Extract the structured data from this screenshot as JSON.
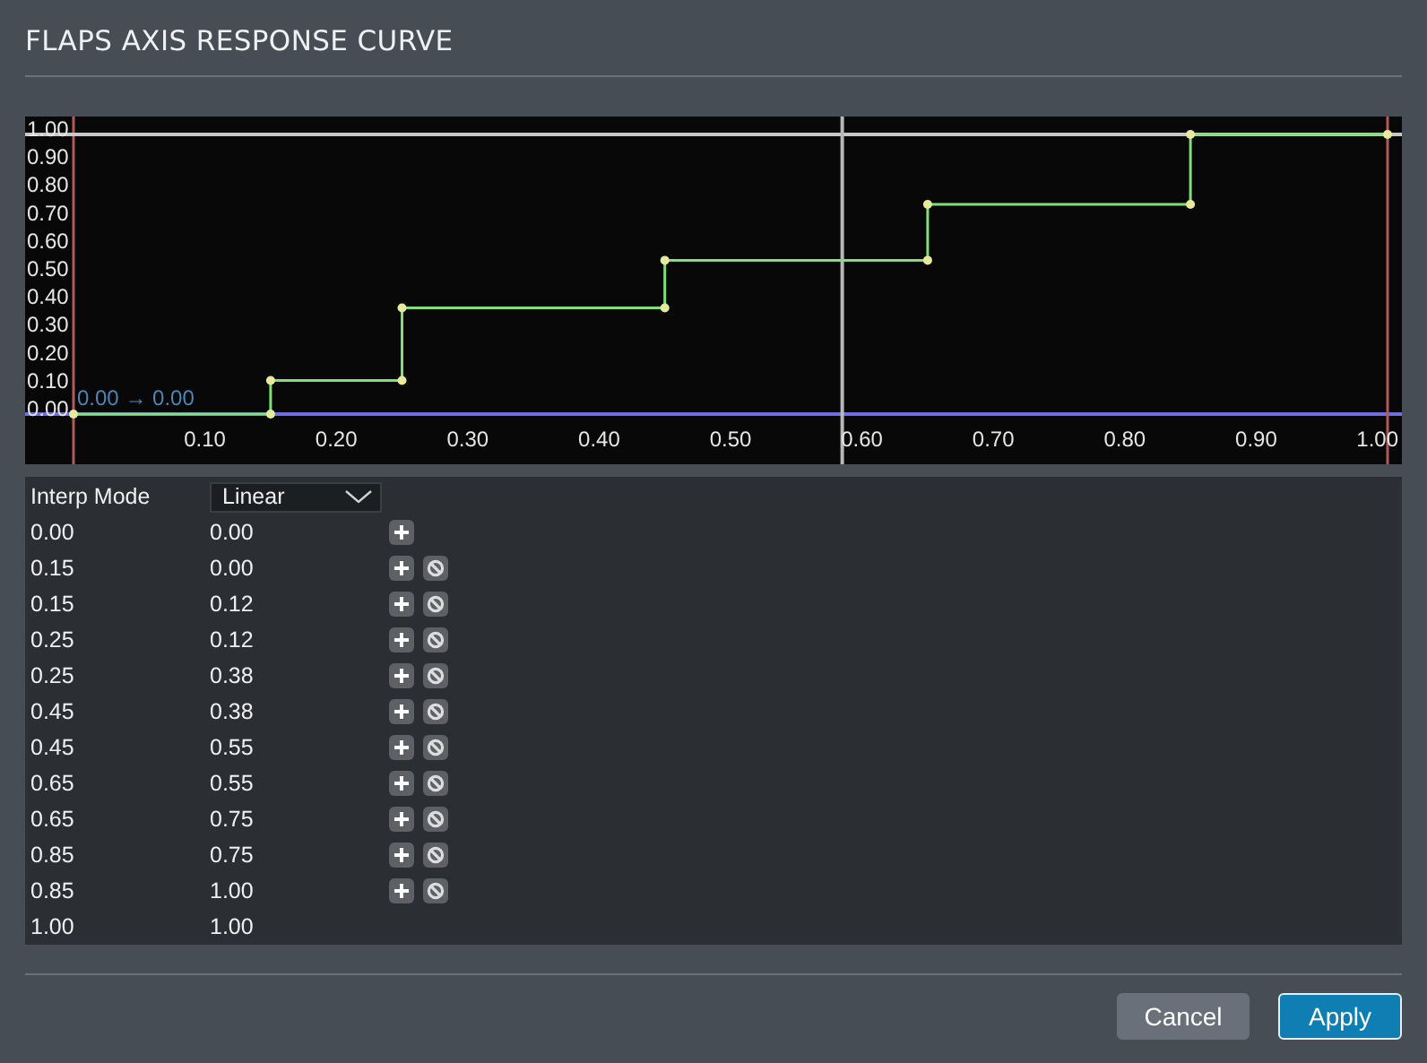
{
  "window": {
    "title": "FLAPS AXIS RESPONSE CURVE"
  },
  "chart": {
    "chart_data": {
      "type": "line",
      "x": [
        0,
        0.15,
        0.15,
        0.25,
        0.25,
        0.45,
        0.45,
        0.65,
        0.65,
        0.85,
        0.85,
        1
      ],
      "series": [
        {
          "color": "#7fe07a",
          "marker": "o",
          "values": [
            0,
            0,
            0.12,
            0.12,
            0.38,
            0.38,
            0.55,
            0.55,
            0.75,
            0.75,
            1,
            1
          ]
        }
      ],
      "xlim": [
        0,
        1
      ],
      "ylim": [
        0,
        1
      ],
      "xticks": [
        {
          "value": 0.1,
          "label": "0.10"
        },
        {
          "value": 0.2,
          "label": "0.20"
        },
        {
          "value": 0.3,
          "label": "0.30"
        },
        {
          "value": 0.4,
          "label": "0.40"
        },
        {
          "value": 0.5,
          "label": "0.50"
        },
        {
          "value": 0.6,
          "label": "0.60"
        },
        {
          "value": 0.7,
          "label": "0.70"
        },
        {
          "value": 0.8,
          "label": "0.80"
        },
        {
          "value": 0.9,
          "label": "0.90"
        },
        {
          "value": 1,
          "label": "1.00"
        }
      ],
      "yticks": [
        {
          "value": 0,
          "label": "0.00"
        },
        {
          "value": 0.1,
          "label": "0.10"
        },
        {
          "value": 0.2,
          "label": "0.20"
        },
        {
          "value": 0.3,
          "label": "0.30"
        },
        {
          "value": 0.4,
          "label": "0.40"
        },
        {
          "value": 0.5,
          "label": "0.50"
        },
        {
          "value": 0.6,
          "label": "0.60"
        },
        {
          "value": 0.7,
          "label": "0.70"
        },
        {
          "value": 0.8,
          "label": "0.80"
        },
        {
          "value": 0.9,
          "label": "0.90"
        },
        {
          "value": 1,
          "label": "1.00"
        }
      ],
      "ref_lines": [
        {
          "axis": "y",
          "value": 1,
          "color": "#c8c8c8"
        },
        {
          "axis": "x",
          "value": 0.585,
          "color": "#b8b8b8"
        }
      ],
      "annotations": [
        "0.00 → 0.00"
      ]
    }
  },
  "interp_mode": {
    "label": "Interp Mode",
    "value": "Linear"
  },
  "points": [
    {
      "input": "0.00",
      "output": "0.00",
      "add": true,
      "remove": false
    },
    {
      "input": "0.15",
      "output": "0.00",
      "add": true,
      "remove": true
    },
    {
      "input": "0.15",
      "output": "0.12",
      "add": true,
      "remove": true
    },
    {
      "input": "0.25",
      "output": "0.12",
      "add": true,
      "remove": true
    },
    {
      "input": "0.25",
      "output": "0.38",
      "add": true,
      "remove": true
    },
    {
      "input": "0.45",
      "output": "0.38",
      "add": true,
      "remove": true
    },
    {
      "input": "0.45",
      "output": "0.55",
      "add": true,
      "remove": true
    },
    {
      "input": "0.65",
      "output": "0.55",
      "add": true,
      "remove": true
    },
    {
      "input": "0.65",
      "output": "0.75",
      "add": true,
      "remove": true
    },
    {
      "input": "0.85",
      "output": "0.75",
      "add": true,
      "remove": true
    },
    {
      "input": "0.85",
      "output": "1.00",
      "add": true,
      "remove": true
    },
    {
      "input": "1.00",
      "output": "1.00",
      "add": false,
      "remove": false
    }
  ],
  "buttons": [
    {
      "label": "Cancel",
      "kind": "secondary"
    },
    {
      "label": "Apply",
      "kind": "primary"
    }
  ]
}
